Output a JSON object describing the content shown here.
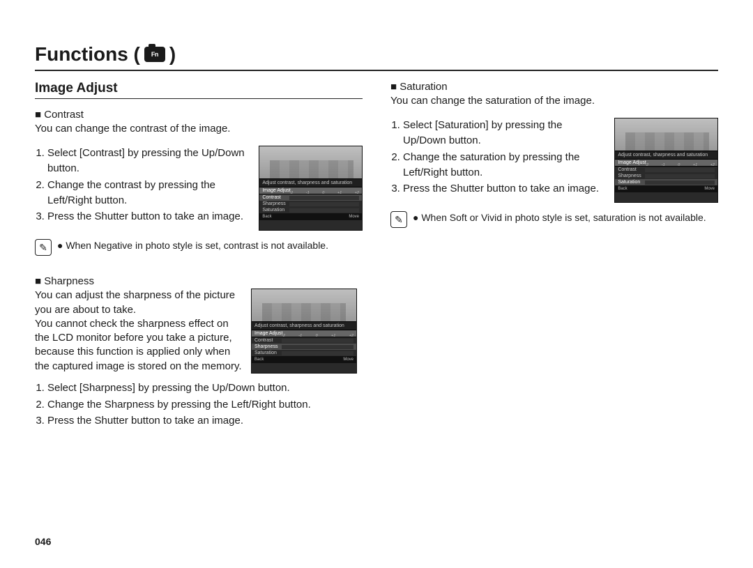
{
  "title_prefix": "Functions (",
  "title_suffix": " )",
  "cam_icon_label": "Fn",
  "section_title": "Image Adjust",
  "contrast": {
    "heading": "■ Contrast",
    "desc": "You can change the contrast of the image.",
    "steps": [
      "Select [Contrast] by pressing the Up/Down button.",
      "Change the contrast by pressing the Left/Right button.",
      "Press the Shutter button to take an image."
    ],
    "note": "● When Negative in photo style is set, contrast is not available."
  },
  "sharpness": {
    "heading": "■ Sharpness",
    "desc1": "You can adjust the sharpness of the picture you are about to take.",
    "desc2": "You cannot check the sharpness effect on the LCD monitor before you take a picture, because this function is applied only when the captured image is stored on the memory.",
    "steps": [
      "Select [Sharpness] by pressing the Up/Down button.",
      "Change the Sharpness by pressing the Left/Right button.",
      "Press the Shutter button to take an image."
    ]
  },
  "saturation": {
    "heading": "■ Saturation",
    "desc": "You can change the saturation of the image.",
    "steps": [
      "Select [Saturation] by pressing the Up/Down button.",
      "Change the saturation by pressing the Left/Right button.",
      "Press the Shutter button to take an image."
    ],
    "note": "● When Soft or Vivid in photo style is set, saturation is not available."
  },
  "lcd": {
    "hint": "Adjust contrast, sharpness and saturation",
    "submenu": "Image Adjust",
    "ticks": [
      "-2",
      "-1",
      "0",
      "+1",
      "+2"
    ],
    "rows": [
      "Contrast",
      "Sharpness",
      "Saturation"
    ],
    "back": "Back",
    "move": "Move"
  },
  "page_number": "046"
}
